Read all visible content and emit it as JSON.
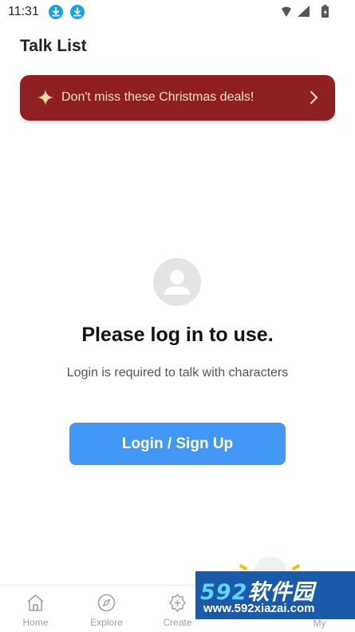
{
  "status_bar": {
    "time": "11:31",
    "icons": [
      "download-icon",
      "download-icon",
      "wifi-icon",
      "signal-icon",
      "battery-icon"
    ]
  },
  "header": {
    "title": "Talk List"
  },
  "promo": {
    "text": "Don't miss these Christmas deals!",
    "background": "#8e1f22",
    "text_color": "#f6e2c4"
  },
  "empty_state": {
    "title": "Please log in to use.",
    "subtitle": "Login is required to talk with characters",
    "button_label": "Login / Sign Up",
    "button_color": "#4296f4"
  },
  "bottom_nav": {
    "items": [
      {
        "label": "Home",
        "icon": "home-icon"
      },
      {
        "label": "Explore",
        "icon": "compass-icon"
      },
      {
        "label": "Create",
        "icon": "create-icon"
      },
      {
        "label": "",
        "icon": "talk-icon"
      },
      {
        "label": "My",
        "icon": "profile-icon"
      }
    ]
  },
  "watermark": {
    "logo_num": "592",
    "logo_text": "软件园",
    "url": "www.592xiazai.com"
  }
}
